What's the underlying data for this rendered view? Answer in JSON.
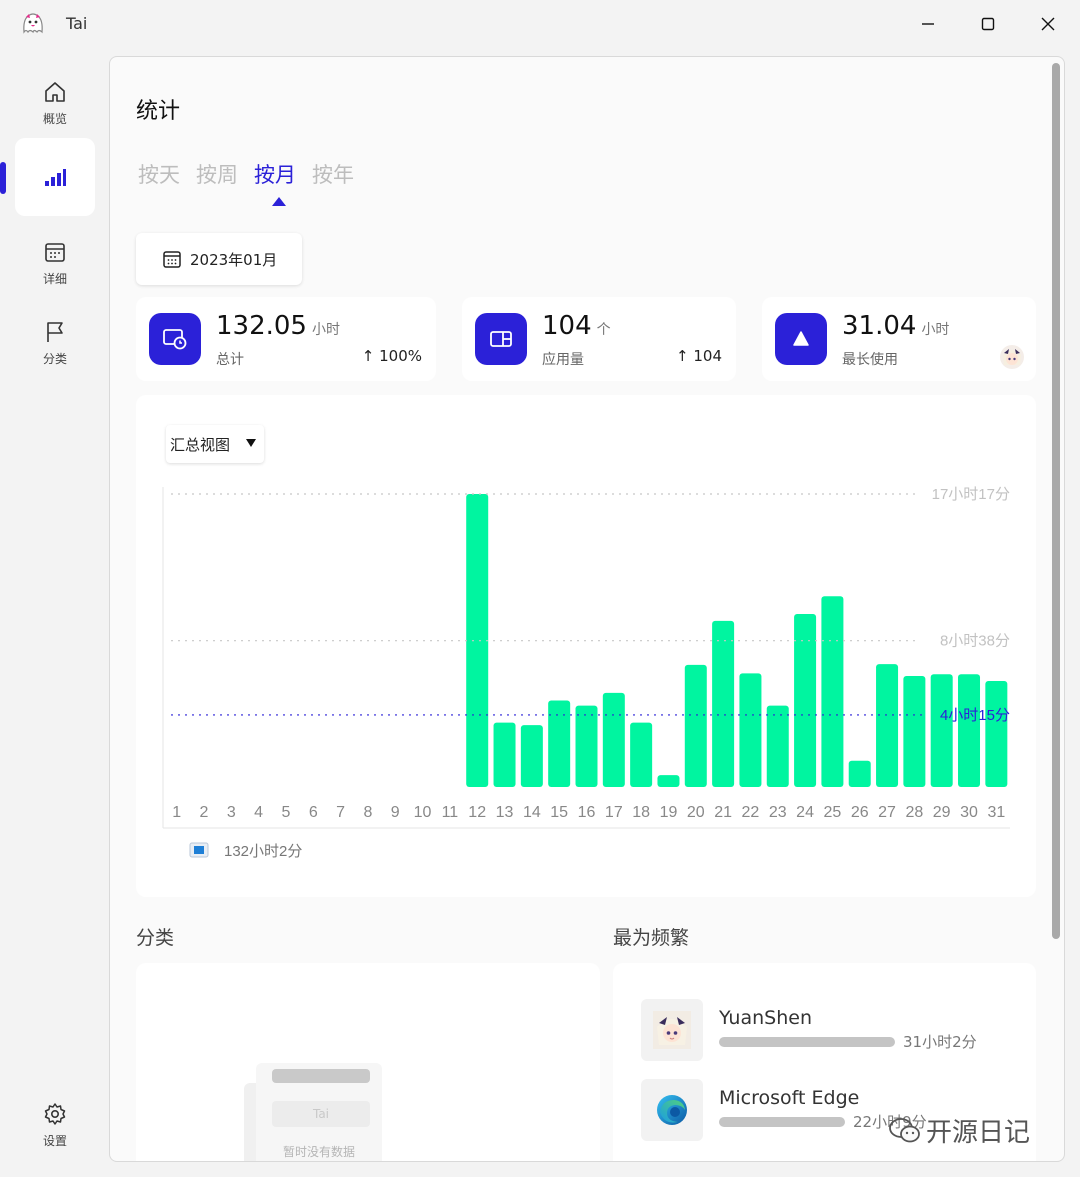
{
  "window": {
    "title": "Tai"
  },
  "sidebar": {
    "items": [
      {
        "label": "概览",
        "icon": "home-icon"
      },
      {
        "label": "",
        "icon": "bar-chart-icon",
        "active": true
      },
      {
        "label": "详细",
        "icon": "calendar-icon"
      },
      {
        "label": "分类",
        "icon": "flag-icon"
      }
    ],
    "settings_label": "设置"
  },
  "page": {
    "title": "统计",
    "tabs": [
      {
        "label": "按天"
      },
      {
        "label": "按周"
      },
      {
        "label": "按月",
        "active": true
      },
      {
        "label": "按年"
      }
    ],
    "date": "2023年01月"
  },
  "stats": {
    "total": {
      "value": "132.05",
      "unit": "小时",
      "label": "总计",
      "delta": "100%"
    },
    "apps": {
      "value": "104",
      "unit": "个",
      "label": "应用量",
      "delta": "104"
    },
    "longest": {
      "value": "31.04",
      "unit": "小时",
      "label": "最长使用"
    }
  },
  "chart": {
    "view_label": "汇总视图"
  },
  "chart_data": {
    "type": "bar",
    "categories": [
      "1",
      "2",
      "3",
      "4",
      "5",
      "6",
      "7",
      "8",
      "9",
      "10",
      "11",
      "12",
      "13",
      "14",
      "15",
      "16",
      "17",
      "18",
      "19",
      "20",
      "21",
      "22",
      "23",
      "24",
      "25",
      "26",
      "27",
      "28",
      "29",
      "30",
      "31"
    ],
    "series": [
      {
        "name": "132小时2分",
        "values": [
          0,
          0,
          0,
          0,
          0,
          0,
          0,
          0,
          0,
          0,
          0,
          17.28,
          3.8,
          3.65,
          5.1,
          4.8,
          5.55,
          3.8,
          0.7,
          7.2,
          9.8,
          6.7,
          4.8,
          10.2,
          11.25,
          1.55,
          7.25,
          6.55,
          6.65,
          6.65,
          6.25
        ]
      }
    ],
    "reference_lines": [
      {
        "label": "17小时17分",
        "value": 17.28,
        "style": "max"
      },
      {
        "label": "8小时38分",
        "value": 8.63,
        "style": "mid"
      },
      {
        "label": "4小时15分",
        "value": 4.25,
        "style": "average"
      }
    ],
    "ylim": [
      0,
      17.28
    ],
    "legend": "bottom-left",
    "colors": {
      "bar": "#00f5a0",
      "average": "#2b21d8",
      "grid": "#c8c8c8"
    }
  },
  "sections": {
    "category_title": "分类",
    "frequent_title": "最为频繁"
  },
  "category": {
    "empty_pill": "Tai",
    "empty_text": "暂时没有数据"
  },
  "frequent": [
    {
      "name": "YuanShen",
      "time": "31小时2分",
      "share": 0.88,
      "icon": "yuanshen-avatar-icon"
    },
    {
      "name": "Microsoft Edge",
      "time": "22小时9分",
      "share": 0.63,
      "icon": "edge-icon"
    }
  ],
  "watermark": "开源日记",
  "colors": {
    "accent": "#2b21d8",
    "bar": "#00f5a0"
  }
}
